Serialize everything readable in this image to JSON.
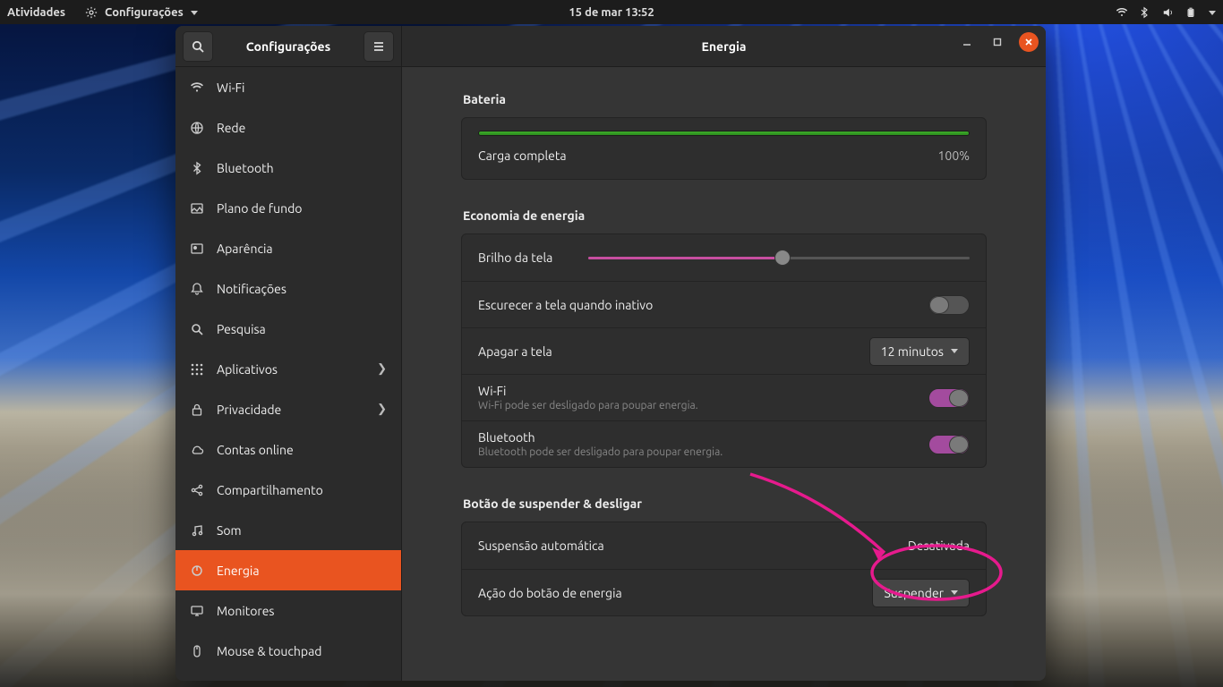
{
  "topbar": {
    "activities": "Atividades",
    "appmenu": "Configurações",
    "datetime": "15 de mar  13:52"
  },
  "sidebar": {
    "title": "Configurações",
    "items": [
      {
        "icon": "wifi",
        "label": "Wi-Fi"
      },
      {
        "icon": "globe",
        "label": "Rede"
      },
      {
        "icon": "bluetooth",
        "label": "Bluetooth"
      },
      {
        "icon": "background",
        "label": "Plano de fundo"
      },
      {
        "icon": "appearance",
        "label": "Aparência"
      },
      {
        "icon": "bell",
        "label": "Notificações"
      },
      {
        "icon": "search",
        "label": "Pesquisa"
      },
      {
        "icon": "apps",
        "label": "Aplicativos",
        "chev": true
      },
      {
        "icon": "lock",
        "label": "Privacidade",
        "chev": true
      },
      {
        "icon": "cloud",
        "label": "Contas online"
      },
      {
        "icon": "share",
        "label": "Compartilhamento"
      },
      {
        "icon": "music",
        "label": "Som"
      },
      {
        "icon": "power",
        "label": "Energia",
        "active": true
      },
      {
        "icon": "monitor",
        "label": "Monitores"
      },
      {
        "icon": "mouse",
        "label": "Mouse & touchpad"
      }
    ]
  },
  "content": {
    "title": "Energia",
    "battery": {
      "heading": "Bateria",
      "status": "Carga completa",
      "percent_label": "100%",
      "fill_pct": 100
    },
    "powersave": {
      "heading": "Economia de energia",
      "brightness": {
        "label": "Brilho da tela",
        "value_pct": 51
      },
      "dim": {
        "label": "Escurecer a tela quando inativo",
        "on": false
      },
      "blank": {
        "label": "Apagar a tela",
        "value": "12 minutos"
      },
      "wifi": {
        "label": "Wi-Fi",
        "sub": "Wi-Fi pode ser desligado para poupar energia.",
        "on": true
      },
      "bluetooth": {
        "label": "Bluetooth",
        "sub": "Bluetooth pode ser desligado para poupar energia.",
        "on": true
      }
    },
    "suspend": {
      "heading": "Botão de suspender & desligar",
      "auto": {
        "label": "Suspensão automática",
        "value": "Desativada"
      },
      "button_action": {
        "label": "Ação do botão de energia",
        "value": "Suspender"
      }
    }
  }
}
